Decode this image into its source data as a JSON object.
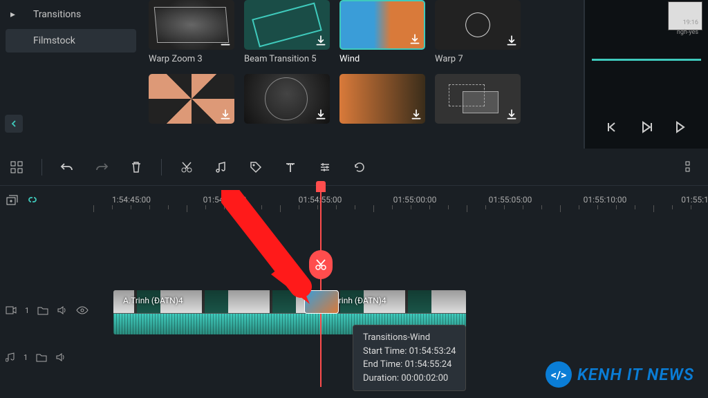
{
  "sidebar": {
    "items": [
      {
        "label": "Transitions"
      },
      {
        "label": "Filmstock"
      }
    ]
  },
  "gallery": {
    "row1": [
      {
        "label": "Warp Zoom 3",
        "selected": false
      },
      {
        "label": "Beam Transition 5",
        "selected": false
      },
      {
        "label": "Wind",
        "selected": true
      },
      {
        "label": "Warp 7",
        "selected": false
      }
    ]
  },
  "preview": {
    "sub1": "19:16",
    "sub2": "ngh-yes"
  },
  "timeline": {
    "marks": [
      "1:54:45:00",
      "01:54:50:00",
      "01:54:55:00",
      "01:55:00:00",
      "01:55:05:00",
      "01:55:10:00",
      "01:55:1"
    ],
    "clip1": "A.Trinh  (ĐATN)4",
    "clip2": "A.Trinh  (ĐATN)4"
  },
  "tooltip": {
    "title": "Transitions-Wind",
    "start": "Start Time: 01:54:53:24",
    "end": "End Time: 01:54:55:24",
    "duration": "Duration: 00:00:02:00"
  },
  "tracks": {
    "video": "1",
    "audio": "1"
  },
  "watermark": "KENH IT NEWS"
}
